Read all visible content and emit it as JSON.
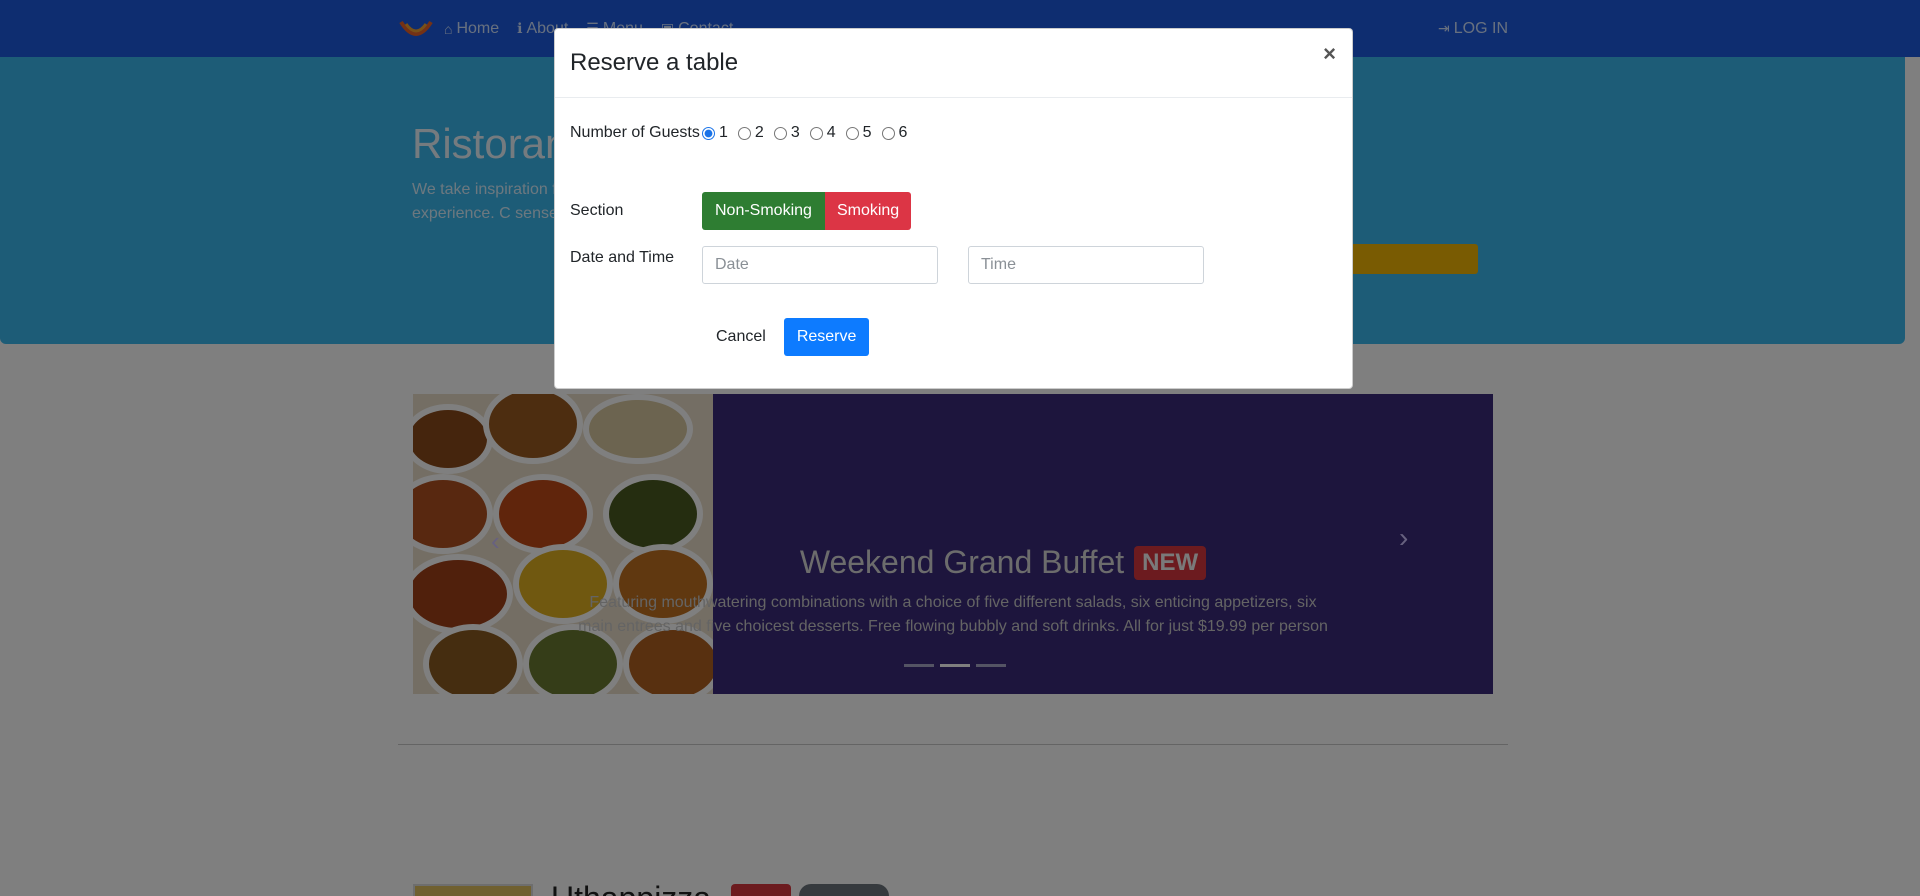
{
  "navbar": {
    "links": [
      {
        "label": "Home",
        "icon": "home-icon"
      },
      {
        "label": "About",
        "icon": "info-icon"
      },
      {
        "label": "Menu",
        "icon": "list-icon"
      },
      {
        "label": "Contact",
        "icon": "address-card-icon"
      }
    ],
    "login_label": "LOG IN"
  },
  "jumbotron": {
    "title": "Ristoran",
    "text": "We take inspiration fusion experience. C senses!"
  },
  "carousel": {
    "title": "Weekend Grand Buffet",
    "badge": "NEW",
    "text": "Featuring mouthwatering combinations with a choice of five different salads, six enticing appetizers, six main entrees and five choicest desserts. Free flowing bubbly and soft drinks. All for just $19.99 per person",
    "slide_count": 3,
    "active_slide": 2
  },
  "media": {
    "title": "Uthappizza"
  },
  "modal": {
    "title": "Reserve a table",
    "close_symbol": "×",
    "guests_label": "Number of Guests",
    "guest_options": [
      "1",
      "2",
      "3",
      "4",
      "5",
      "6"
    ],
    "guest_selected": "1",
    "section_label": "Section",
    "section_options": [
      "Non-Smoking",
      "Smoking"
    ],
    "datetime_label": "Date and Time",
    "date_placeholder": "Date",
    "time_placeholder": "Time",
    "cancel_label": "Cancel",
    "reserve_label": "Reserve"
  },
  "colors": {
    "navbar": "#1c5be0",
    "jumbotron": "#3bb8ef",
    "carousel": "#3a2a7a",
    "non_smoking": "#2e7d32",
    "smoking": "#dc3545",
    "reserve": "#0d7bff"
  }
}
